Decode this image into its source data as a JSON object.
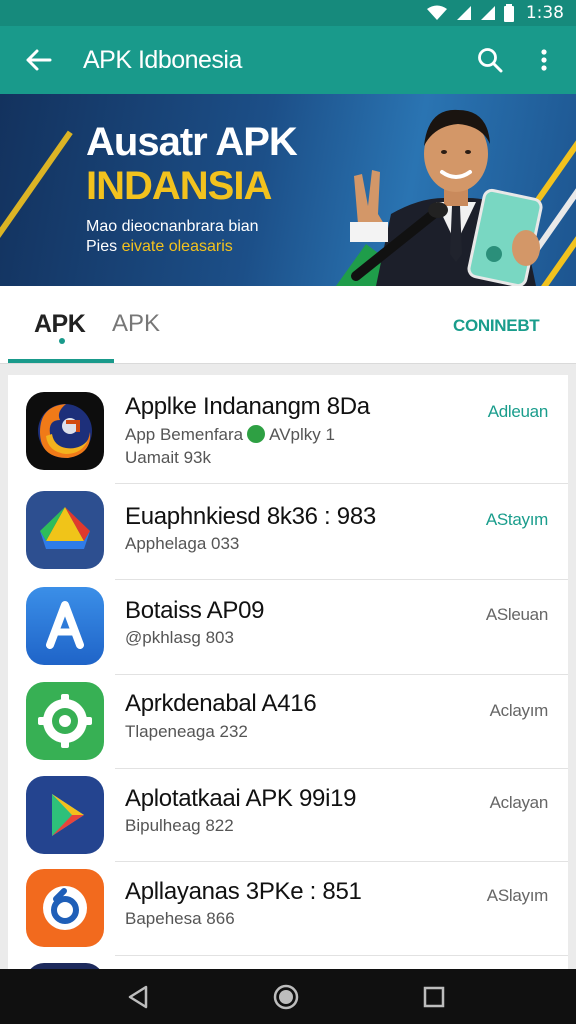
{
  "status_bar": {
    "time": "1:38"
  },
  "app_bar": {
    "title": "APK Idbonesia"
  },
  "banner": {
    "headline": "Ausatr APK",
    "subline": "INDANSIA",
    "line1": "Mao dieocnanbrara bian",
    "line2_a": "Pies",
    "line2_b": "eivate oleasaris"
  },
  "tabs": {
    "active": "APK",
    "second": "APK",
    "connect": "CONINEBT"
  },
  "apps": [
    {
      "name": "Applke Indanangm 8Da",
      "sub_a": "App Bemenfara",
      "sub_b": "AVplky 1",
      "sub2": "Uamait 93k",
      "action": "Adleuan",
      "action_color": "#1a9d8c"
    },
    {
      "name": "Euaphnkiesd 8k36 : 983",
      "sub": "Apphelaga   033",
      "action": "AStayım",
      "action_color": "#1a9d8c"
    },
    {
      "name": "Botaiss AP09",
      "sub": "@pkhlasg   803",
      "action": "ASleuan",
      "action_color": "#666666"
    },
    {
      "name": "Aprkdenabal A416",
      "sub": "Tlapeneaga   232",
      "action": "Aclayım",
      "action_color": "#666666"
    },
    {
      "name": "Aplotatkaai APK 99i19",
      "sub": "Bipulheag   822",
      "action": "Aclayan",
      "action_color": "#666666"
    },
    {
      "name": "Apllayanas 3PKe : 851",
      "sub": "Bapehesa   866",
      "action": "ASlayım",
      "action_color": "#666666"
    }
  ],
  "colors": {
    "primary": "#199a8b",
    "status": "#168a7c",
    "accent_text": "#1a9d8c",
    "banner_yellow": "#f2c21e"
  }
}
